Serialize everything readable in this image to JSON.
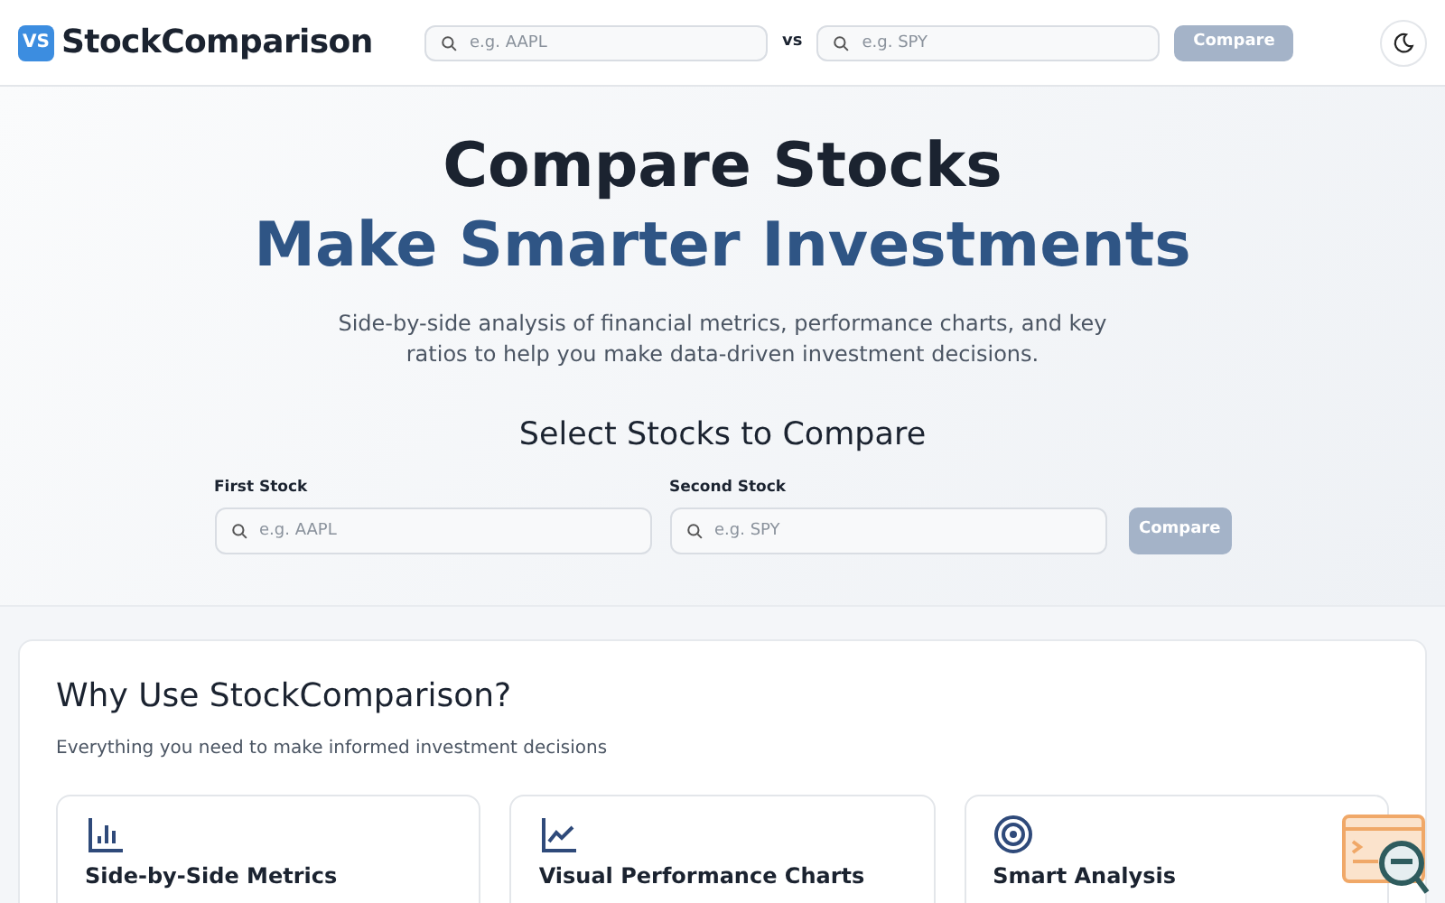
{
  "navbar": {
    "logo_badge": "VS",
    "brand": "StockComparison",
    "first_search": {
      "placeholder": "e.g. AAPL"
    },
    "separator": "vs",
    "second_search": {
      "placeholder": "e.g. SPY"
    },
    "compare_button": {
      "label": "Compare",
      "disabled": true
    }
  },
  "hero": {
    "title": "Compare Stocks",
    "subtitle": "Make Smarter Investments",
    "description": "Side-by-side analysis of financial metrics, performance charts, and key ratios to help you make data-driven investment decisions.",
    "form_title": "Select Stocks to Compare",
    "fields": [
      {
        "label": "First Stock",
        "placeholder": "e.g. AAPL"
      },
      {
        "label": "Second Stock",
        "placeholder": "e.g. SPY"
      }
    ],
    "compare_button": {
      "label": "Compare",
      "disabled": true
    }
  },
  "features": {
    "title": "Why Use StockComparison?",
    "subtitle": "Everything you need to make informed investment decisions",
    "cards": [
      {
        "kind": "bars",
        "title": "Side-by-Side Metrics"
      },
      {
        "kind": "line",
        "title": "Visual Performance Charts"
      },
      {
        "kind": "target",
        "title": "Smart Analysis"
      }
    ]
  }
}
